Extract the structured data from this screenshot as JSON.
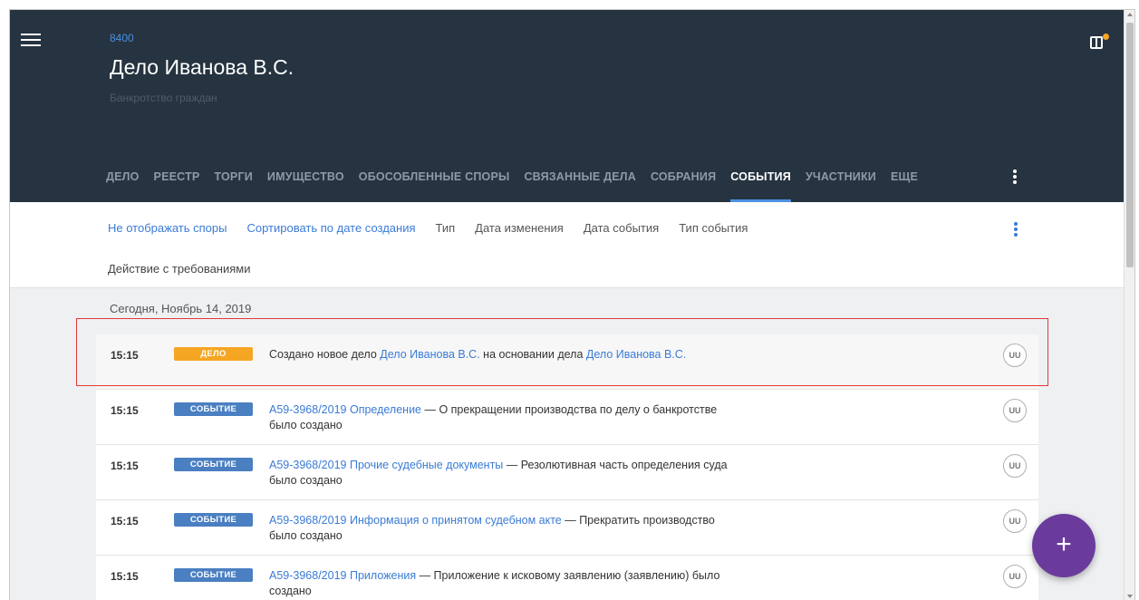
{
  "header": {
    "case_number": "8400",
    "title": "Дело Иванова В.С.",
    "subtitle": "Банкротство граждан"
  },
  "tabs": [
    {
      "label": "ДЕЛО"
    },
    {
      "label": "РЕЕСТР"
    },
    {
      "label": "ТОРГИ"
    },
    {
      "label": "ИМУЩЕСТВО"
    },
    {
      "label": "ОБОСОБЛЕННЫЕ СПОРЫ"
    },
    {
      "label": "СВЯЗАННЫЕ ДЕЛА"
    },
    {
      "label": "СОБРАНИЯ"
    },
    {
      "label": "СОБЫТИЯ"
    },
    {
      "label": "УЧАСТНИКИ"
    },
    {
      "label": "ЕЩЕ"
    }
  ],
  "active_tab": "СОБЫТИЯ",
  "filters": {
    "hide_disputes": "Не отображать споры",
    "sort_by_created": "Сортировать по дате создания",
    "type": "Тип",
    "date_changed": "Дата изменения",
    "event_date": "Дата события",
    "event_type": "Тип события",
    "claims_action": "Действие с требованиями"
  },
  "date_group": "Сегодня, Ноябрь 14, 2019",
  "events": [
    {
      "time": "15:15",
      "badge": "ДЕЛО",
      "text1": "Создано новое дело ",
      "link1": "Дело Иванова В.С.",
      "text2": " на основании дела ",
      "link2": "Дело Иванова В.С.",
      "text3": "",
      "avatar": "UU"
    },
    {
      "time": "15:15",
      "badge": "СОБЫТИЕ",
      "text1": "",
      "link1": "А59-3968/2019 Определение",
      "text2": " — О прекращении производства по делу о банкротстве было создано",
      "link2": "",
      "text3": "",
      "avatar": "UU"
    },
    {
      "time": "15:15",
      "badge": "СОБЫТИЕ",
      "text1": "",
      "link1": "А59-3968/2019 Прочие судебные документы",
      "text2": " — Резолютивная часть определения суда было создано",
      "link2": "",
      "text3": "",
      "avatar": "UU"
    },
    {
      "time": "15:15",
      "badge": "СОБЫТИЕ",
      "text1": "",
      "link1": "А59-3968/2019 Информация о принятом судебном акте",
      "text2": " — Прекратить производство было создано",
      "link2": "",
      "text3": "",
      "avatar": "UU"
    },
    {
      "time": "15:15",
      "badge": "СОБЫТИЕ",
      "text1": "",
      "link1": "А59-3968/2019 Приложения",
      "text2": " — Приложение к исковому заявлению (заявлению) было создано",
      "link2": "",
      "text3": "",
      "avatar": "UU"
    }
  ],
  "fab_label": "+",
  "icons": {
    "menu": "hamburger-icon",
    "panel": "side-panel-icon",
    "more": "more-vert-icon",
    "add": "plus-icon"
  },
  "colors": {
    "header_bg": "#263340",
    "link": "#3a7bd5",
    "badge_case": "#f5a623",
    "badge_event": "#4a7fc1",
    "fab": "#6a3b9c",
    "highlight_border": "#e53935"
  }
}
